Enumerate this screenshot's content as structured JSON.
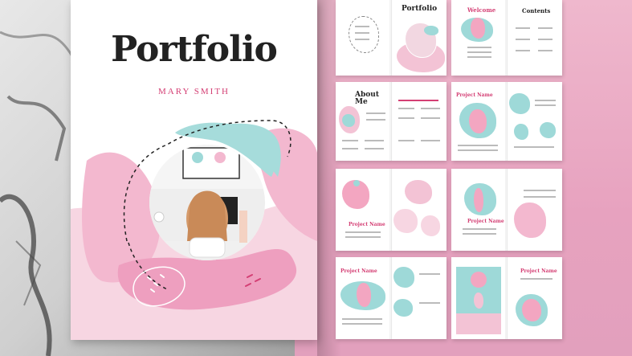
{
  "cover": {
    "title": "Portfolio",
    "author": "MARY SMITH"
  },
  "spreads": {
    "s1": {
      "title": "Portfolio"
    },
    "s2": {
      "left_title": "Welcome",
      "right_title": "Contents"
    },
    "s3": {
      "left_title": "About Me"
    },
    "s4": {
      "left_title": "Project Name"
    },
    "s5": {
      "left_title": "Project Name"
    },
    "s6": {
      "left_title": "Project Name"
    },
    "s7": {
      "left_title": "Project Name"
    },
    "s8": {
      "right_title": "Project Name"
    }
  },
  "colors": {
    "pink": "#f3c3d5",
    "hotpink": "#d43f74",
    "teal": "#9ed9d8",
    "background": "#e9a8c2"
  }
}
